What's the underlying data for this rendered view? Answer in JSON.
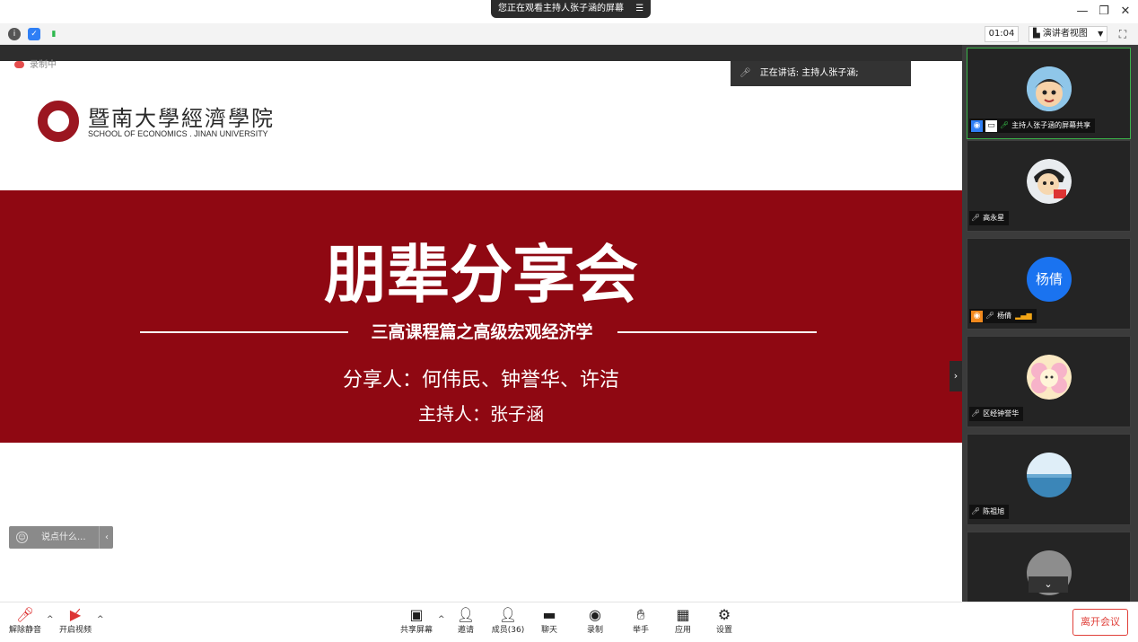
{
  "titlebar": {
    "share_notice": "您正在观看主持人张子涵的屏幕",
    "share_menu_icon": "menu-lines-icon",
    "minimize": "—",
    "restore": "❐",
    "close": "✕"
  },
  "toolbar": {
    "timer": "01:04",
    "view_label": "演讲者视图"
  },
  "share": {
    "recording_label": "录制中",
    "speaking_label": "正在讲话: 主持人张子涵;"
  },
  "slide": {
    "logo_cn": "暨南大學經濟學院",
    "logo_en": "SCHOOL OF ECONOMICS . JINAN UNIVERSITY",
    "title": "朋辈分享会",
    "subtitle": "三高课程篇之高级宏观经济学",
    "sharers": "分享人：何伟民、钟誉华、许洁",
    "host": "主持人：张子涵",
    "band_color": "#8f0812"
  },
  "chat": {
    "placeholder": "说点什么..."
  },
  "participants": [
    {
      "name": "主持人张子涵的屏幕共享",
      "avatar": "cartoon-boy"
    },
    {
      "name": "高永星",
      "avatar": "cartoon-kid"
    },
    {
      "name": "杨倩",
      "avatar_text": "杨倩",
      "avatar_color": "#1a73f0"
    },
    {
      "name": "区经钟誉华",
      "avatar": "flower"
    },
    {
      "name": "陈祖旭",
      "avatar": "sea"
    },
    {
      "name": "",
      "avatar": "gray"
    }
  ],
  "bottombar": {
    "unmute": "解除静音",
    "start_video": "开启视频",
    "share_screen": "共享屏幕",
    "invite": "邀请",
    "members": "成员(36)",
    "chat": "聊天",
    "record": "录制",
    "raise_hand": "举手",
    "apps": "应用",
    "settings": "设置",
    "leave": "离开会议"
  }
}
